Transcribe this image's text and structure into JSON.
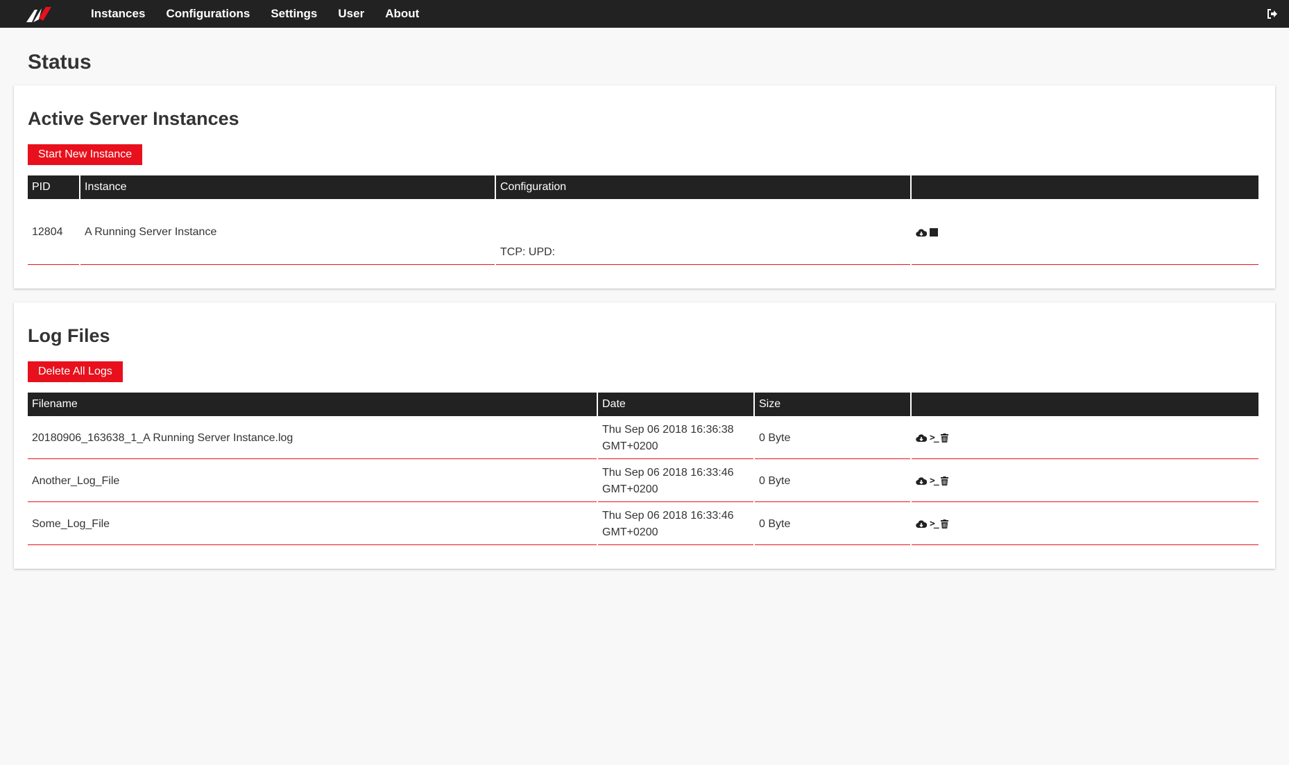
{
  "nav": {
    "items": [
      {
        "label": "Instances"
      },
      {
        "label": "Configurations"
      },
      {
        "label": "Settings"
      },
      {
        "label": "User"
      },
      {
        "label": "About"
      }
    ],
    "logo_icon": "ac-logo",
    "logout_icon": "sign-out-icon"
  },
  "page": {
    "title": "Status"
  },
  "instances": {
    "title": "Active Server Instances",
    "button_label": "Start New Instance",
    "headers": [
      "PID",
      "Instance",
      "Configuration",
      ""
    ],
    "rows": [
      {
        "pid": "12804",
        "instance": "A Running Server Instance",
        "configuration": "TCP: UPD:"
      }
    ]
  },
  "logs": {
    "title": "Log Files",
    "button_label": "Delete All Logs",
    "headers": [
      "Filename",
      "Date",
      "Size",
      ""
    ],
    "rows": [
      {
        "filename": "20180906_163638_1_A Running Server Instance.log",
        "date": "Thu Sep 06 2018 16:36:38 GMT+0200",
        "size": "0 Byte"
      },
      {
        "filename": "Another_Log_File",
        "date": "Thu Sep 06 2018 16:33:46 GMT+0200",
        "size": "0 Byte"
      },
      {
        "filename": "Some_Log_File",
        "date": "Thu Sep 06 2018 16:33:46 GMT+0200",
        "size": "0 Byte"
      }
    ]
  },
  "colors": {
    "accent": "#e8101c",
    "navbar": "#222222",
    "background": "#f8f8f8"
  },
  "terminal_glyph": ">_"
}
